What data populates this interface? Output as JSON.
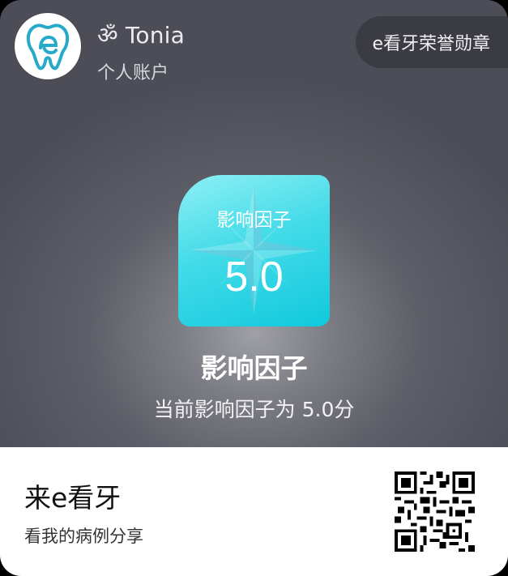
{
  "header": {
    "username": "ॐ Tonia",
    "account_type": "个人账户",
    "honor_button": "e看牙荣誉勋章"
  },
  "badge": {
    "label": "影响因子",
    "value": "5.0"
  },
  "achievement": {
    "title": "影响因子",
    "subtitle": "当前影响因子为 5.0分"
  },
  "footer": {
    "brand": "来e看牙",
    "share_text": "看我的病例分享"
  },
  "colors": {
    "badge_accent": "#1ccbe0",
    "logo_teal": "#27a9c9"
  },
  "icons": {
    "avatar": "tooth-logo-icon",
    "badge_bg": "compass-star-icon",
    "qr": "qr-code-icon"
  }
}
